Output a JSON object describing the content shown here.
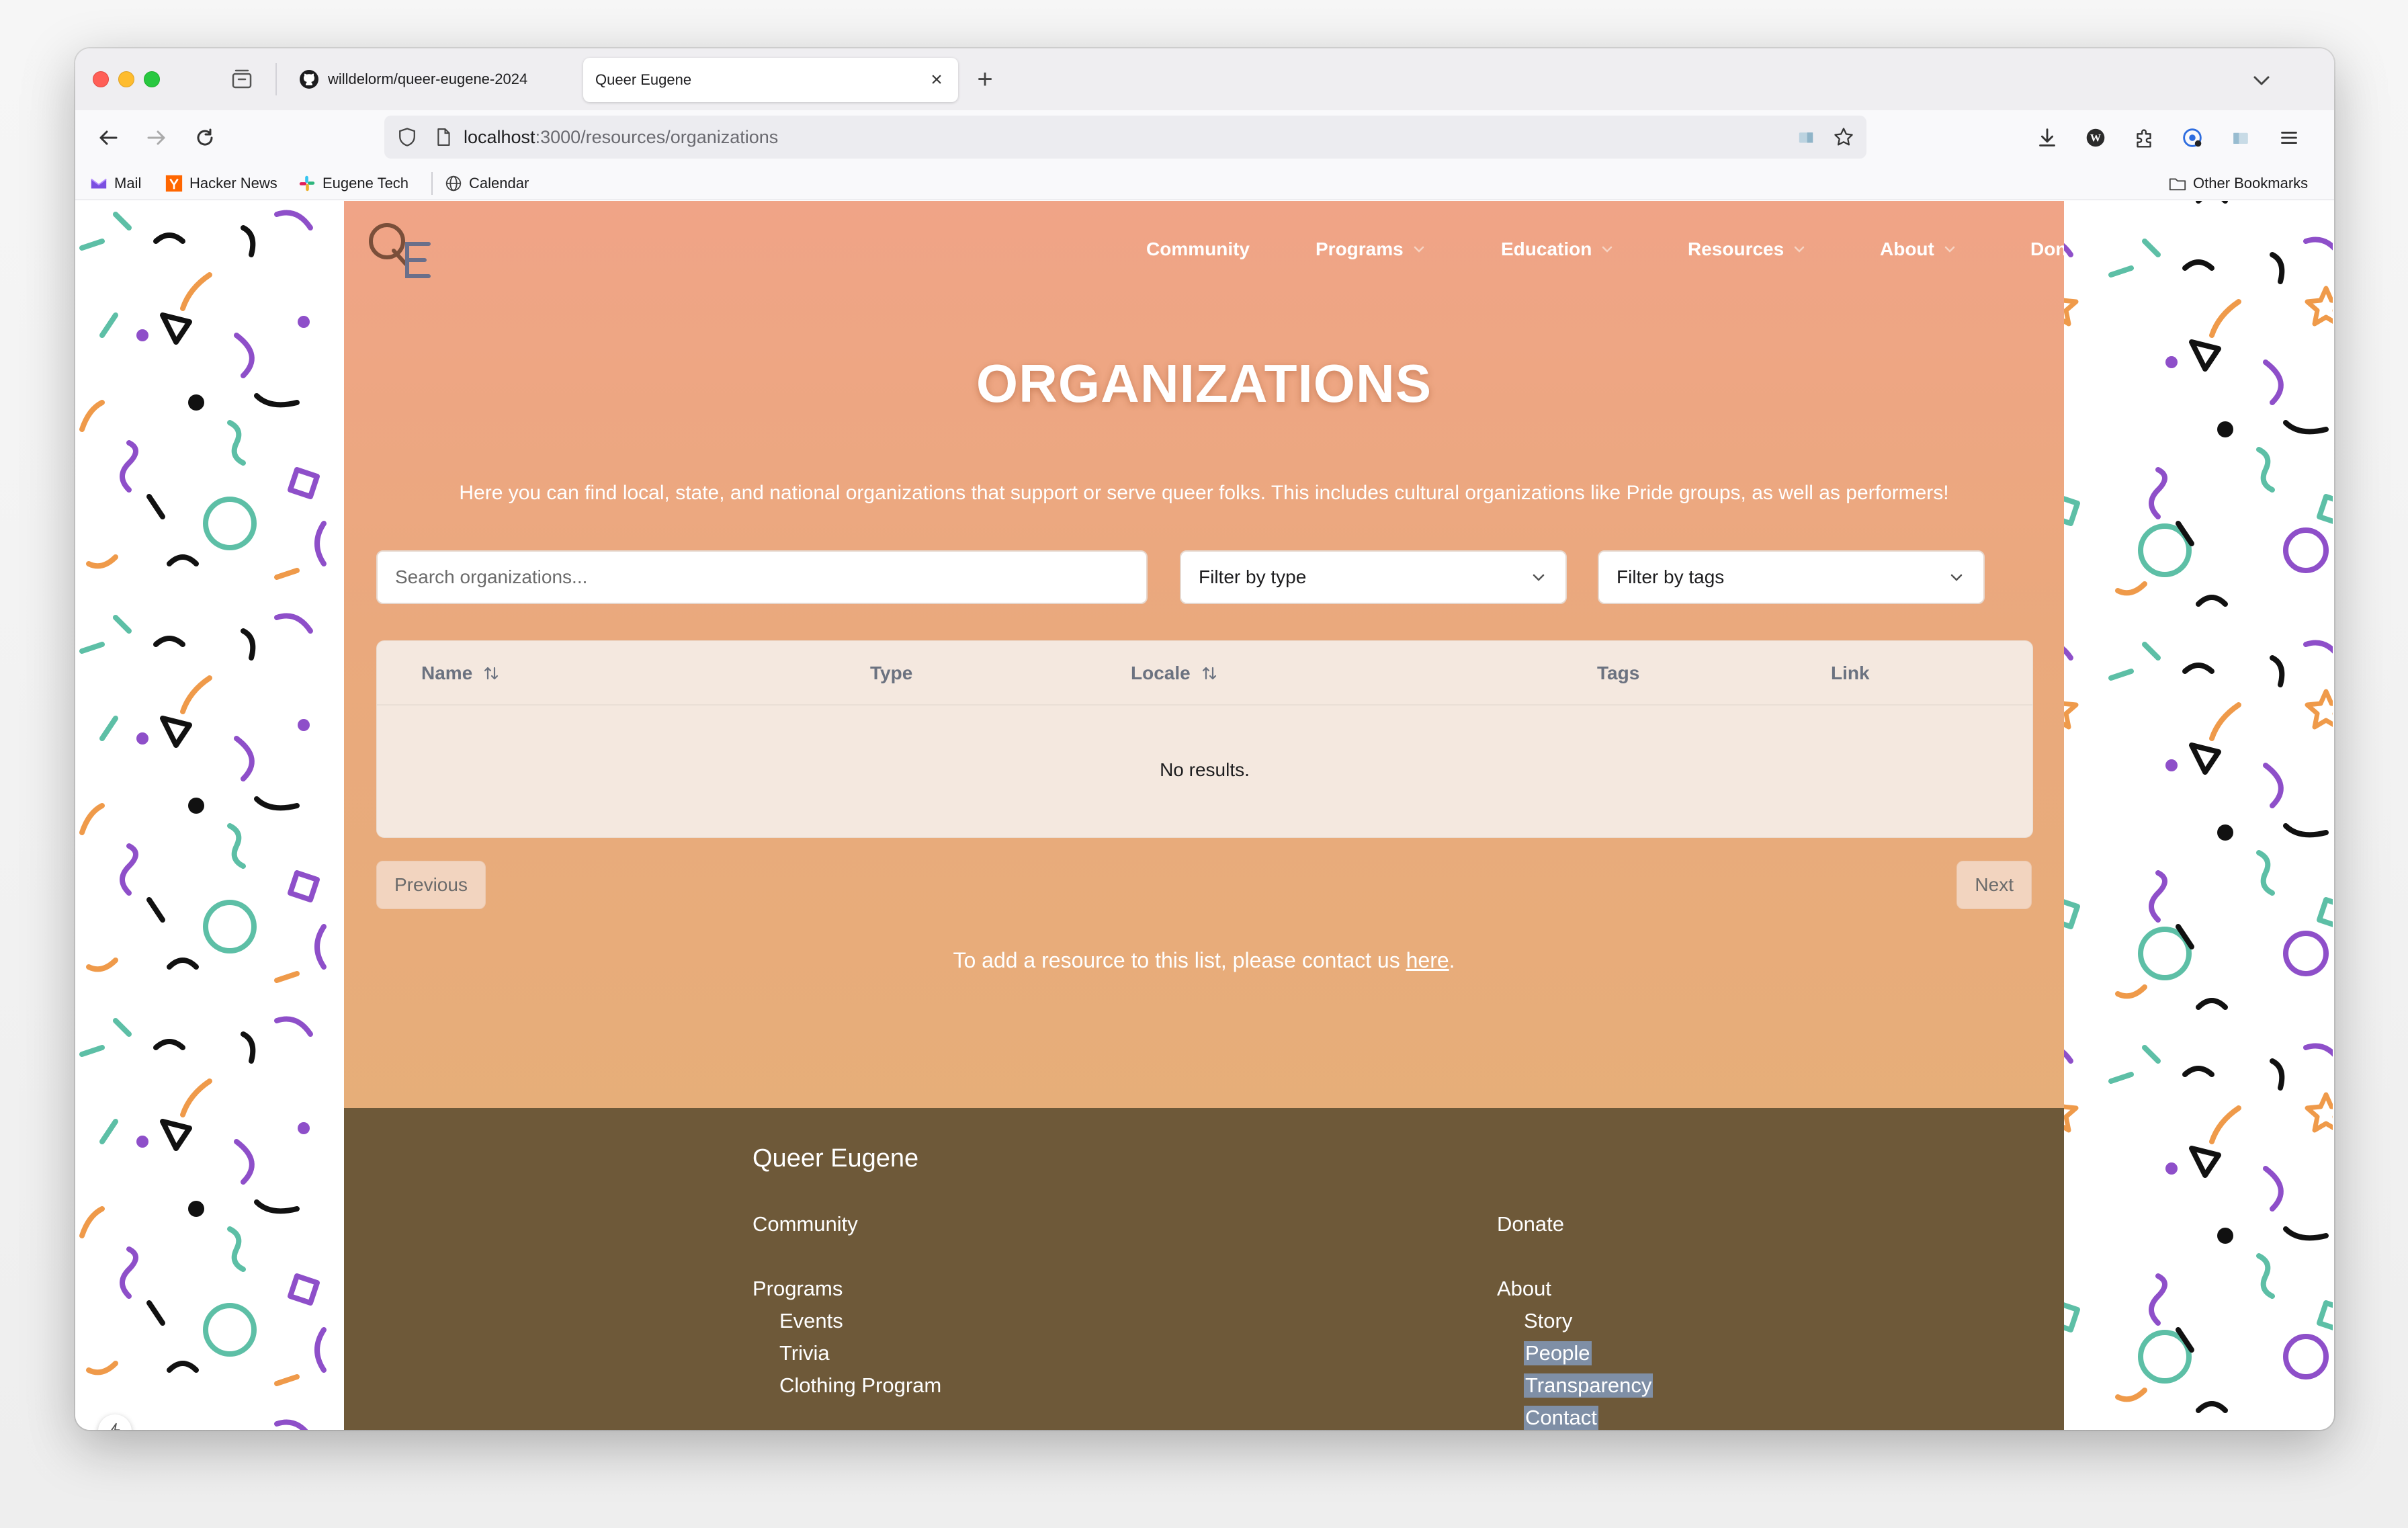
{
  "browser": {
    "tabs": [
      {
        "title": "willdelorm/queer-eugene-2024",
        "icon": "github-icon",
        "active": false
      },
      {
        "title": "Queer Eugene",
        "icon": "",
        "active": true
      }
    ],
    "url": {
      "host": "localhost",
      "path": ":3000/resources/organizations"
    },
    "bookmarks": [
      {
        "label": "Mail",
        "icon": "mail-icon"
      },
      {
        "label": "Hacker News",
        "icon": "hacker-news-icon"
      },
      {
        "label": "Eugene Tech",
        "icon": "slack-icon"
      },
      {
        "label": "Calendar",
        "icon": "globe-icon"
      }
    ],
    "other_bookmarks": "Other Bookmarks"
  },
  "site": {
    "nav": [
      {
        "label": "Community",
        "dropdown": false
      },
      {
        "label": "Programs",
        "dropdown": true
      },
      {
        "label": "Education",
        "dropdown": true
      },
      {
        "label": "Resources",
        "dropdown": true
      },
      {
        "label": "About",
        "dropdown": true
      },
      {
        "label": "Donate",
        "dropdown": false
      }
    ],
    "title": "ORGANIZATIONS",
    "intro": "Here you can find local, state, and national organizations that support or serve queer folks. This includes cultural organizations like Pride groups, as well as performers!",
    "search_placeholder": "Search organizations...",
    "filter_type": "Filter by type",
    "filter_tags": "Filter by tags",
    "table": {
      "columns": [
        {
          "label": "Name",
          "sortable": true
        },
        {
          "label": "Type",
          "sortable": false
        },
        {
          "label": "Locale",
          "sortable": true
        },
        {
          "label": "Tags",
          "sortable": false
        },
        {
          "label": "Link",
          "sortable": false
        }
      ],
      "empty": "No results."
    },
    "pagination": {
      "previous": "Previous",
      "next": "Next"
    },
    "contact": {
      "prefix": "To add a resource to this list, please contact us ",
      "link": "here",
      "suffix": "."
    }
  },
  "footer": {
    "brand": "Queer Eugene",
    "community": "Community",
    "programs": {
      "label": "Programs",
      "items": [
        "Events",
        "Trivia",
        "Clothing Program"
      ]
    },
    "donate": "Donate",
    "about": {
      "label": "About",
      "items": [
        "Story",
        "People",
        "Transparency",
        "Contact"
      ]
    }
  },
  "colors": {
    "header_gradient_top": "#f0a487",
    "header_gradient_bottom": "#e4b176",
    "footer_bg": "#6e5939",
    "pattern_purple": "#8e4fc9",
    "pattern_teal": "#5dbfa6",
    "pattern_orange": "#ef9a4a"
  }
}
